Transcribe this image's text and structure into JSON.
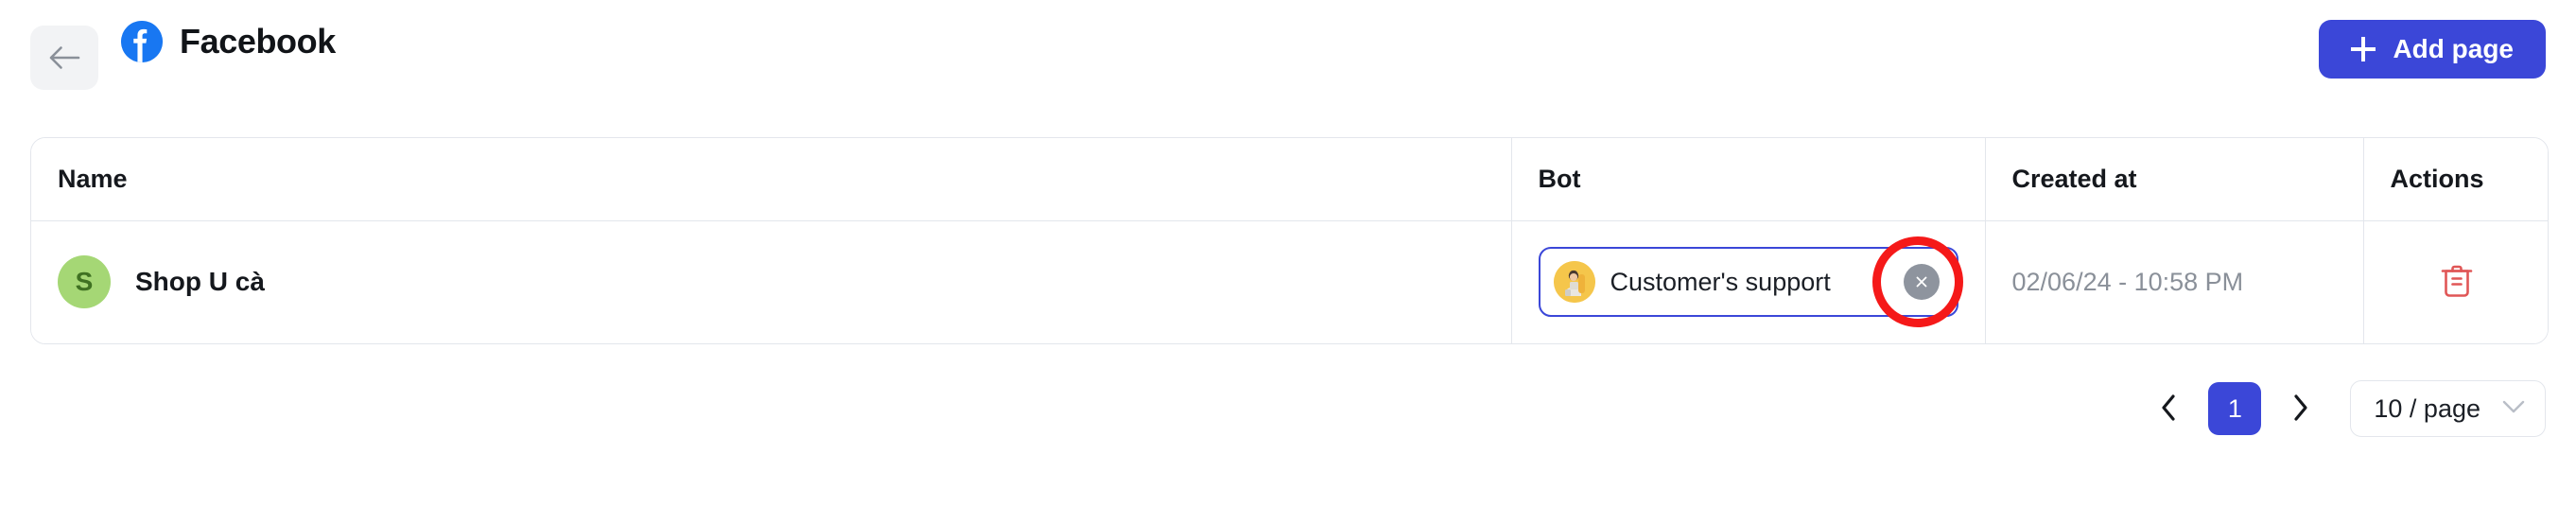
{
  "header": {
    "back_label": "back-arrow",
    "brand_icon": "facebook-logo",
    "title": "Facebook",
    "add_page_label": "Add page",
    "add_icon": "plus-icon"
  },
  "table": {
    "columns": [
      "Name",
      "Bot",
      "Created at",
      "Actions"
    ],
    "rows": [
      {
        "avatar_initial": "S",
        "avatar_color": "#a5d775",
        "name": "Shop U cà",
        "bot": {
          "label": "Customer's support",
          "avatar_icon": "bot-avatar-icon",
          "clear_icon": "close-circle-icon",
          "focused": true,
          "annotated": true
        },
        "created_at": "02/06/24 - 10:58 PM",
        "action_icon": "trash-icon"
      }
    ]
  },
  "pagination": {
    "prev_icon": "chevron-left-icon",
    "next_icon": "chevron-right-icon",
    "current_page": "1",
    "page_size_label": "10 / page",
    "dropdown_icon": "chevron-down-icon"
  },
  "colors": {
    "accent": "#3b47d8",
    "facebook_blue": "#1877f2",
    "danger": "#e05656",
    "annotation_red": "#f51919",
    "muted_text": "#8a9099",
    "border": "#e3e6ec"
  }
}
